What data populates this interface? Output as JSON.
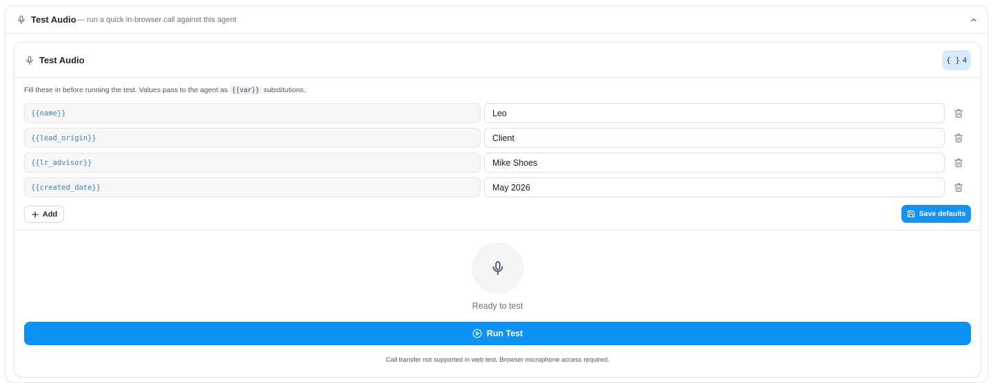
{
  "header": {
    "title": "Test Audio",
    "subtitle": "— run a quick in-browser call against this agent"
  },
  "card": {
    "title": "Test Audio",
    "badge_icon": "{ }",
    "badge_count": "4",
    "hint_before": "Fill these in before running the test. Values pass to the agent as",
    "hint_code": "{{var}}",
    "hint_after": "substitutions."
  },
  "variables": [
    {
      "key": "{{name}}",
      "value": "Leo"
    },
    {
      "key": "{{lead_origin}}",
      "value": "Client"
    },
    {
      "key": "{{lr_advisor}}",
      "value": "Mike Shoes"
    },
    {
      "key": "{{created_date}}",
      "value": "May 2026"
    }
  ],
  "actions": {
    "add_label": "Add",
    "save_label": "Save defaults"
  },
  "test": {
    "status": "Ready to test",
    "run_label": "Run Test",
    "note": "Call transfer not supported in web test. Browser microphone access required."
  },
  "colors": {
    "primary": "#0a93f5",
    "badge_bg": "#d7ebff",
    "var_key": "#3b82c4"
  },
  "icons": {
    "header": "microphone-icon",
    "collapse": "chevron-up-icon",
    "row_delete": "trash-icon",
    "add": "plus-icon",
    "save": "save-icon",
    "run": "play-circle-icon"
  }
}
